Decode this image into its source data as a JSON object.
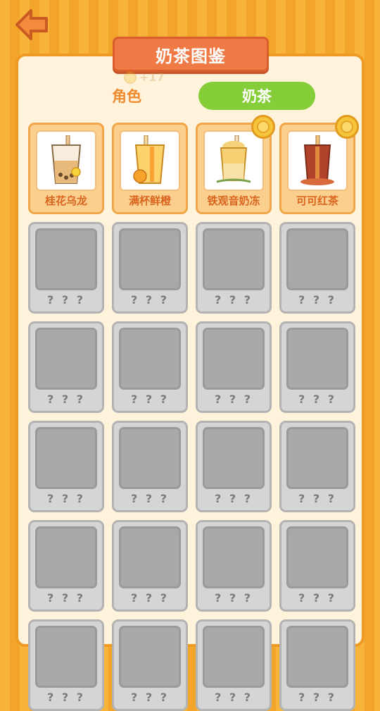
{
  "header": {
    "title": "奶茶图鉴",
    "coin_hint": "+17"
  },
  "tabs": [
    {
      "label": "角色",
      "active": false
    },
    {
      "label": "奶茶",
      "active": true
    }
  ],
  "unlocked_items": [
    {
      "name": "桂花乌龙",
      "has_badge": false,
      "icon": "osmanthus-oolong-drink-icon"
    },
    {
      "name": "满杯鲜橙",
      "has_badge": false,
      "icon": "orange-drink-icon"
    },
    {
      "name": "铁观音奶冻",
      "has_badge": true,
      "icon": "tieguanyin-pudding-drink-icon"
    },
    {
      "name": "可可红茶",
      "has_badge": true,
      "icon": "cocoa-black-tea-drink-icon"
    }
  ],
  "locked_label": "? ? ?",
  "locked_count": 20,
  "colors": {
    "accent_orange": "#f07a45",
    "tab_green": "#86cd3a",
    "locked_gray": "#a9a9a9"
  }
}
